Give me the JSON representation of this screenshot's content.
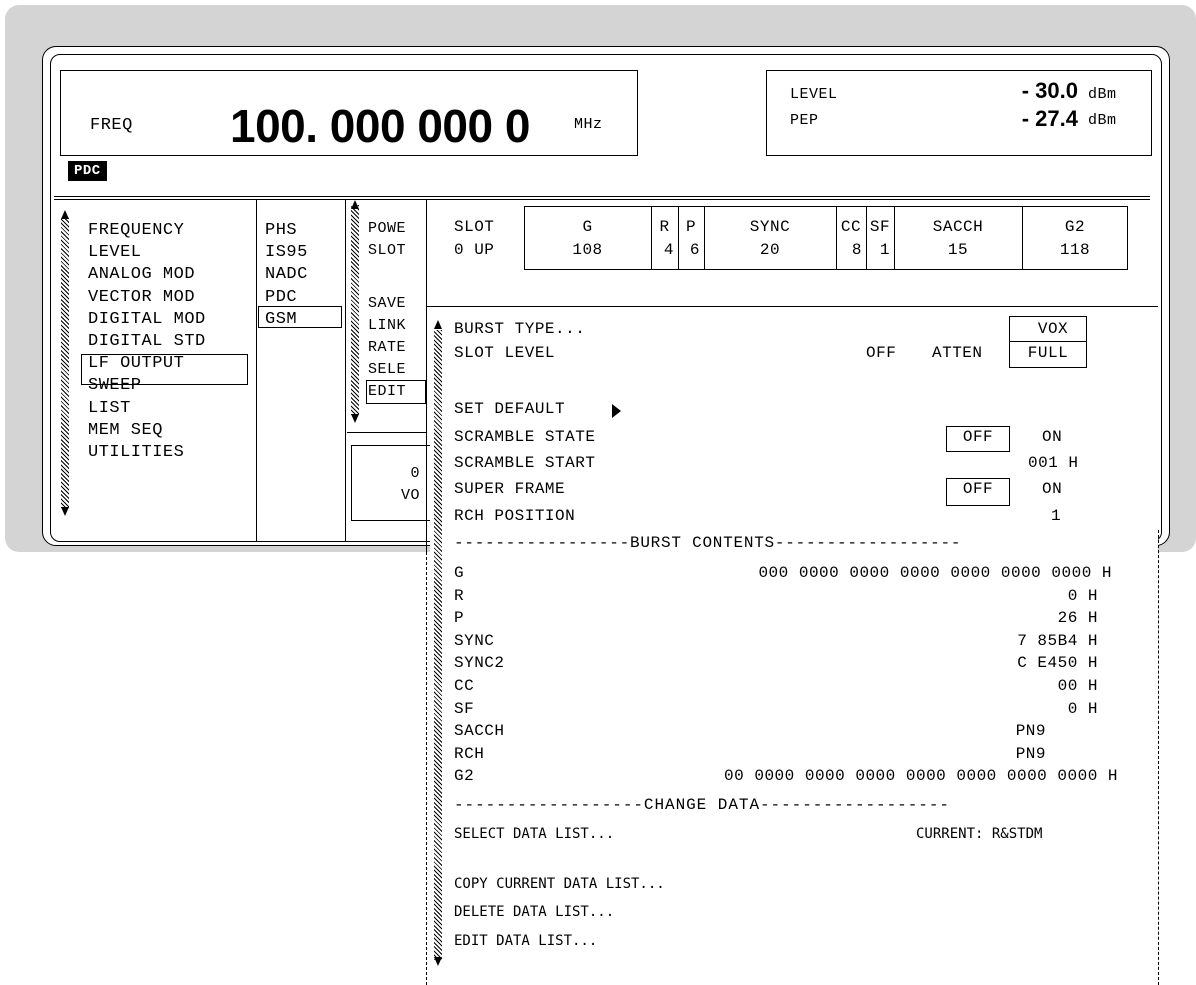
{
  "header": {
    "freq_label": "FREQ",
    "freq_value": "100. 000 000 0",
    "freq_unit": "MHz",
    "level_label": "LEVEL",
    "level_value": "- 30.0",
    "level_unit": "dBm",
    "pep_label": "PEP",
    "pep_value": "- 27.4",
    "pep_unit": "dBm",
    "mode_badge": "PDC"
  },
  "menu1": [
    "FREQUENCY",
    "LEVEL",
    "ANALOG MOD",
    "VECTOR MOD",
    "DIGITAL MOD",
    "DIGITAL STD",
    "LF OUTPUT",
    "SWEEP",
    "LIST",
    "MEM SEQ",
    "UTILITIES"
  ],
  "menu2": [
    "PHS",
    "IS95",
    "NADC",
    "PDC",
    "GSM"
  ],
  "menu3": {
    "items_a": [
      "POWE",
      "SLOT"
    ],
    "items_b": [
      "SAVE",
      "LINK",
      "RATE",
      "SELE",
      "EDIT"
    ],
    "box_line1": "0",
    "box_line2": "VO"
  },
  "slot_table": {
    "slot_label": "SLOT",
    "slot_value": "0 UP",
    "fields": [
      {
        "name": "G",
        "value": "108"
      },
      {
        "name": "R",
        "value": "4"
      },
      {
        "name": "P",
        "value": "6"
      },
      {
        "name": "SYNC",
        "value": "20"
      },
      {
        "name": "CC",
        "value": "8"
      },
      {
        "name": "SF",
        "value": "1"
      },
      {
        "name": "SACCH",
        "value": "15"
      },
      {
        "name": "G2",
        "value": "118"
      }
    ]
  },
  "settings": {
    "burst_type_label": "BURST TYPE...",
    "burst_type_value": "VOX",
    "slot_level_label": "SLOT LEVEL",
    "slot_level_off": "OFF",
    "slot_level_atten": "ATTEN",
    "slot_level_full": "FULL",
    "set_default": "SET DEFAULT",
    "scramble_state_label": "SCRAMBLE STATE",
    "scramble_state_off": "OFF",
    "scramble_state_on": "ON",
    "scramble_start_label": "SCRAMBLE START",
    "scramble_start_value": "001 H",
    "super_frame_label": "SUPER FRAME",
    "super_frame_off": "OFF",
    "super_frame_on": "ON",
    "rch_position_label": "RCH POSITION",
    "rch_position_value": "1"
  },
  "burst_contents": {
    "divider": "-----------------BURST CONTENTS------------------",
    "rows": [
      {
        "label": "G",
        "value": "000 0000 0000 0000 0000 0000 0000 H"
      },
      {
        "label": "R",
        "value": "0 H"
      },
      {
        "label": "P",
        "value": "26 H"
      },
      {
        "label": "SYNC",
        "value": "7 85B4 H"
      },
      {
        "label": "SYNC2",
        "value": "C E450 H"
      },
      {
        "label": "CC",
        "value": "00 H"
      },
      {
        "label": "SF",
        "value": "0 H"
      },
      {
        "label": "SACCH",
        "value": "PN9"
      },
      {
        "label": "RCH",
        "value": "PN9"
      },
      {
        "label": "G2",
        "value": "00 0000 0000 0000 0000 0000 0000 0000 H"
      }
    ]
  },
  "change_data": {
    "divider": "------------------CHANGE DATA------------------",
    "select_label": "SELECT DATA LIST...",
    "current_label": "CURRENT: R&STDM",
    "copy_label": "COPY CURRENT DATA LIST...",
    "delete_label": "DELETE DATA LIST...",
    "edit_label": "EDIT DATA LIST..."
  }
}
